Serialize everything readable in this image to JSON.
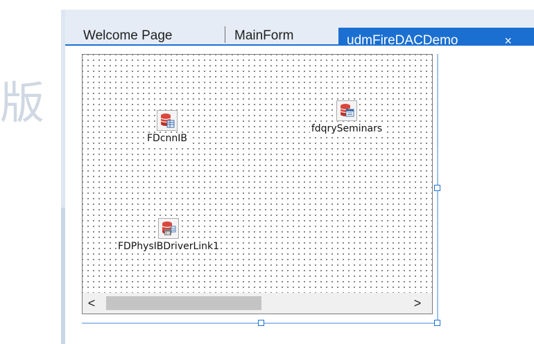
{
  "watermark": "版",
  "tabs": {
    "welcome": "Welcome Page",
    "main": "MainForm",
    "active": "udmFireDACDemo",
    "close_glyph": "×"
  },
  "components": [
    {
      "label": "FDcnnIB",
      "icon": "database-connection-icon"
    },
    {
      "label": "fdqrySeminars",
      "icon": "database-query-icon"
    },
    {
      "label": "FDPhysIBDriverLink1",
      "icon": "interbase-driver-link-icon"
    }
  ],
  "scrollbar": {
    "left_glyph": "<",
    "right_glyph": ">"
  },
  "colors": {
    "accent": "#1b6fd1",
    "tabbar": "#e5ecf6",
    "guide": "#9fc3ea",
    "db_red": "#d9473c"
  }
}
